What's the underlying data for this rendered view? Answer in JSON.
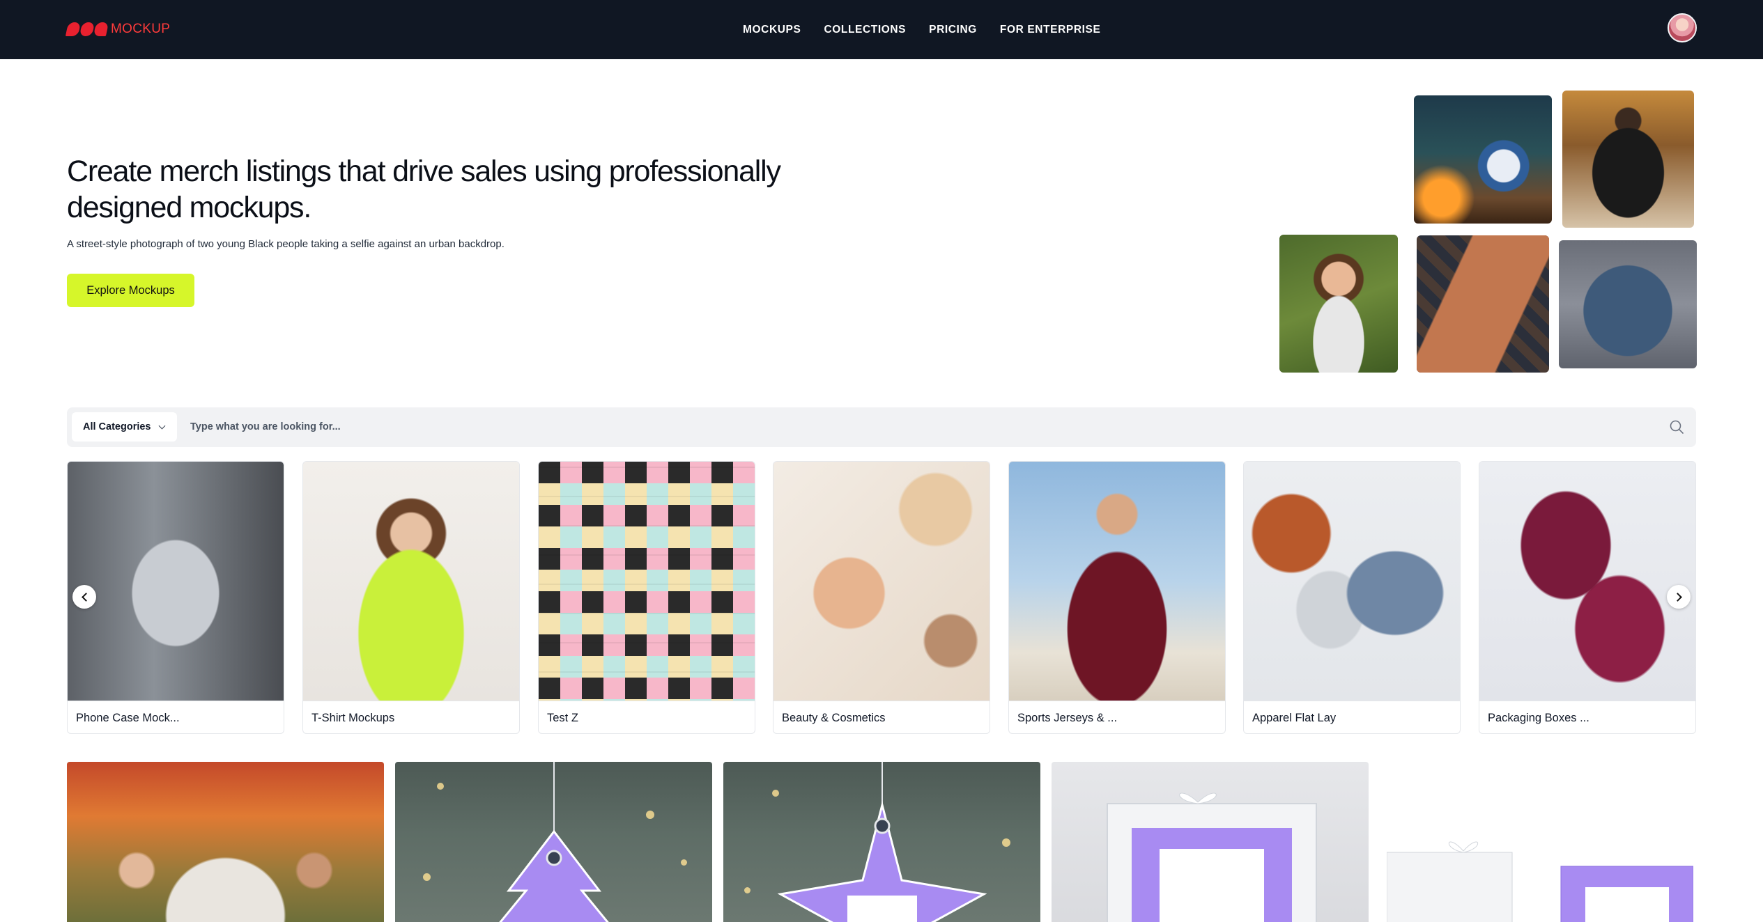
{
  "brand": {
    "logo_text": "MOCKUP",
    "brand_color": "#e8212f"
  },
  "nav": {
    "items": [
      {
        "label": "MOCKUPS"
      },
      {
        "label": "COLLECTIONS"
      },
      {
        "label": "PRICING"
      },
      {
        "label": "FOR ENTERPRISE"
      }
    ]
  },
  "hero": {
    "title": "Create merch listings that drive sales using professionally designed mockups.",
    "subtitle": "A street-style photograph of two young Black people taking a selfie against an urban backdrop.",
    "cta_label": "Explore Mockups",
    "cta_color": "#d6f62a"
  },
  "search": {
    "category_label": "All Categories",
    "placeholder": "Type what you are looking for..."
  },
  "categories": [
    {
      "label": "Phone Case Mock..."
    },
    {
      "label": "T-Shirt Mockups"
    },
    {
      "label": "Test Z"
    },
    {
      "label": "Beauty & Cosmetics"
    },
    {
      "label": "Sports Jerseys & ..."
    },
    {
      "label": "Apparel Flat Lay"
    },
    {
      "label": "Packaging Boxes ..."
    }
  ],
  "colors": {
    "nav_bg": "#101723",
    "mockup_purple": "#a88bf2"
  },
  "icons": [
    "search-icon",
    "chevron-down-icon",
    "chevron-left-icon",
    "chevron-right-icon"
  ]
}
